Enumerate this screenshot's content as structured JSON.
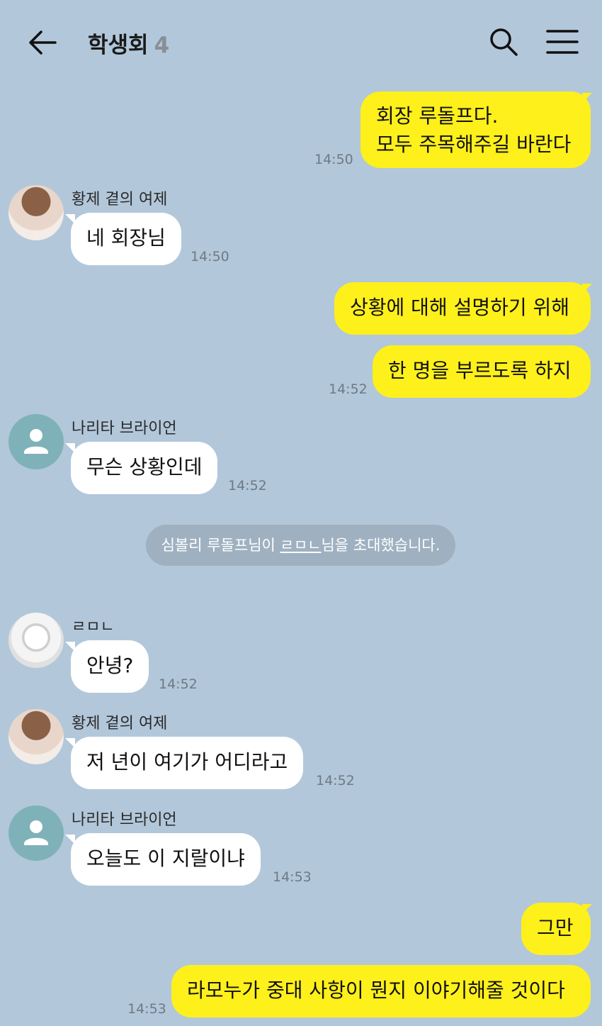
{
  "header": {
    "back_icon": "arrow-left-icon",
    "title": "학생회",
    "member_count": "4",
    "search_icon": "search-icon",
    "menu_icon": "hamburger-menu-icon"
  },
  "messages": {
    "m1": {
      "line1": "회장 루돌프다.",
      "line2": "모두 주목해주길 바란다",
      "time": "14:50"
    },
    "m2": {
      "sender": "황제 곁의 여제",
      "text": "네 회장님",
      "time": "14:50"
    },
    "m3": {
      "text": "상황에 대해 설명하기 위해"
    },
    "m4": {
      "text": "한 명을 부르도록 하지",
      "time": "14:52"
    },
    "m5": {
      "sender": "나리타 브라이언",
      "text": "무슨 상황인데",
      "time": "14:52"
    },
    "notice": {
      "before": "심볼리 루돌프님이 ",
      "invitee": "ㄹㅁㄴ",
      "after": "님을 초대했습니다."
    },
    "m6": {
      "sender": "ㄹㅁㄴ",
      "text": "안녕?",
      "time": "14:52"
    },
    "m7": {
      "sender": "황제 곁의 여제",
      "text": "저 년이 여기가 어디라고",
      "time": "14:52"
    },
    "m8": {
      "sender": "나리타 브라이언",
      "text": "오늘도 이 지랄이냐",
      "time": "14:53"
    },
    "m9": {
      "text": "그만"
    },
    "m10": {
      "text": "라모누가 중대 사항이 뭔지 이야기해줄 것이다",
      "time": "14:53"
    }
  },
  "colors": {
    "background": "#b2c7da",
    "my_bubble": "#fef01b",
    "their_bubble": "#ffffff",
    "default_avatar": "#7fb1b9"
  }
}
